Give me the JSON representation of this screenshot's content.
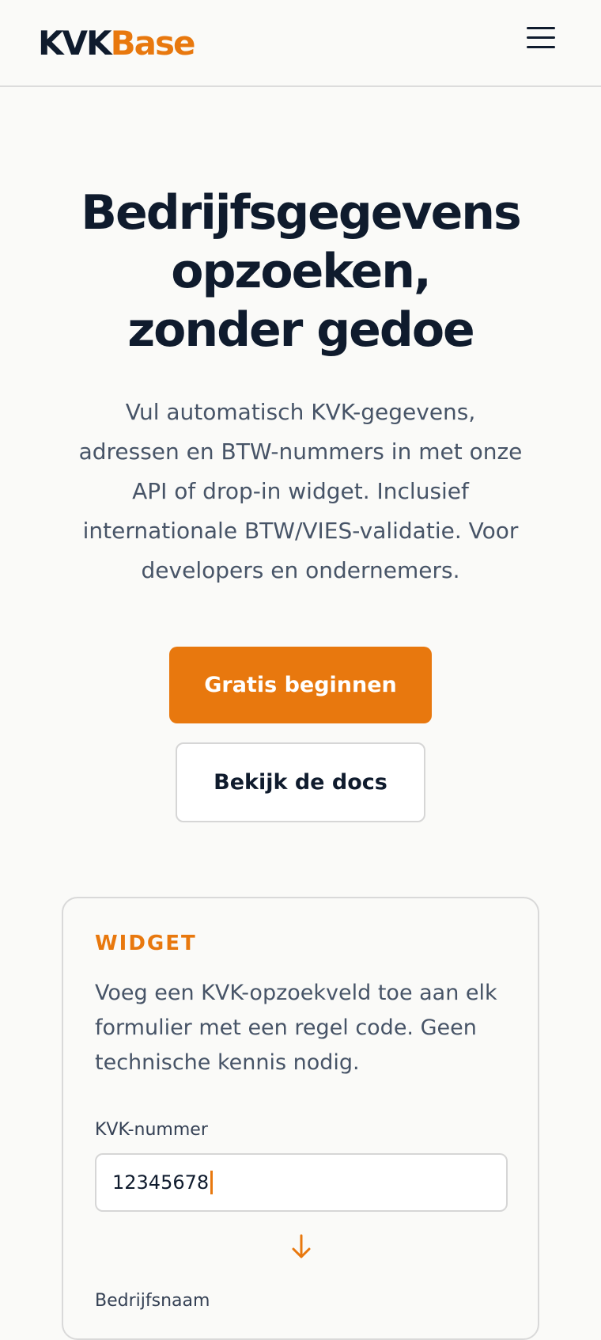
{
  "header": {
    "logo_kvk": "KVK",
    "logo_base": "Base",
    "menu_icon": "hamburger-menu-icon"
  },
  "hero": {
    "title_lines": [
      "Bedrijfsgegevens",
      "opzoeken,",
      "zonder gedoe"
    ],
    "subtitle_lines": [
      "Vul automatisch KVK-gegevens,",
      "adressen en BTW-nummers in met onze",
      "API of drop-in widget. Inclusief",
      "internationale BTW/VIES-validatie. Voor",
      "developers en ondernemers."
    ],
    "primary_button": "Gratis beginnen",
    "secondary_button": "Bekijk de docs"
  },
  "widget_card": {
    "label": "WIDGET",
    "description_lines": [
      "Voeg een KVK-opzoekveld toe aan elk",
      "formulier met een regel code. Geen",
      "technische kennis nodig."
    ],
    "field_label": "KVK-nummer",
    "field_value": "12345678",
    "arrow_icon": "arrow-down-icon",
    "next_field_label": "Bedrijfsnaam"
  },
  "colors": {
    "accent": "#e8780e",
    "text_dark": "#0f1b2d",
    "text_muted": "#475467",
    "background": "#fafaf8"
  }
}
